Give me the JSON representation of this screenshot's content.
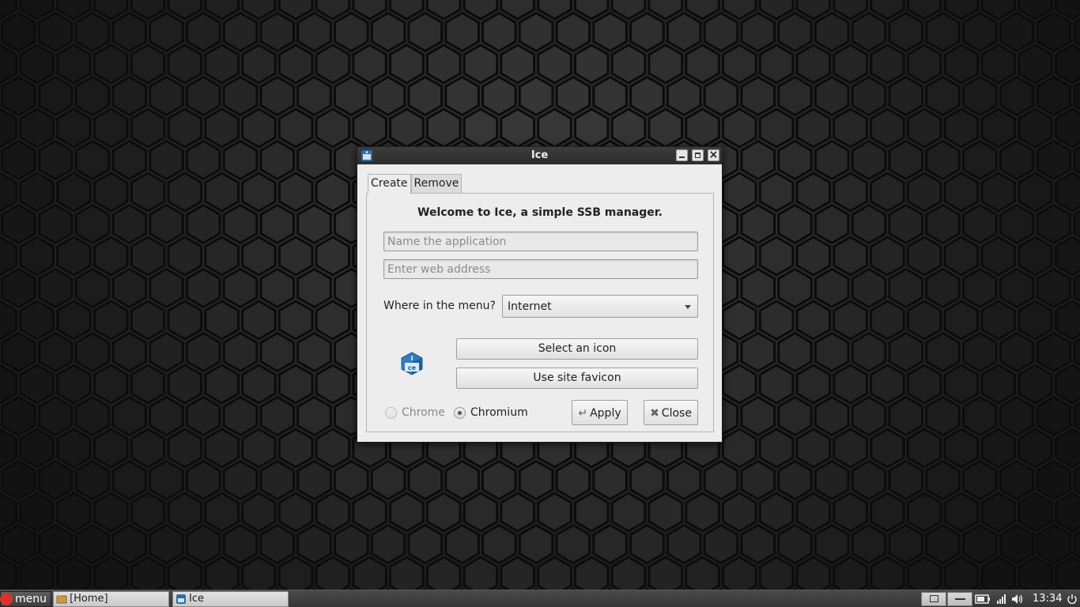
{
  "window": {
    "title": "Ice",
    "tabs": [
      {
        "label": "Create",
        "active": true
      },
      {
        "label": "Remove",
        "active": false
      }
    ],
    "welcome": "Welcome to Ice, a simple SSB manager.",
    "name_input": {
      "placeholder": "Name the application",
      "value": ""
    },
    "url_input": {
      "placeholder": "Enter web address",
      "value": ""
    },
    "menu_label": "Where in the menu?",
    "menu_select": {
      "value": "Internet"
    },
    "select_icon_label": "Select an icon",
    "favicon_label": "Use site favicon",
    "browsers": [
      {
        "label": "Chrome",
        "checked": false,
        "enabled": false
      },
      {
        "label": "Chromium",
        "checked": true,
        "enabled": true
      }
    ],
    "apply_label": "Apply",
    "close_label": "Close",
    "icon_letters": "ice"
  },
  "taskbar": {
    "menu_label": "menu",
    "tasks": [
      {
        "label": "[Home]",
        "icon": "folder-icon"
      },
      {
        "label": "Ice",
        "icon": "ice-app-icon"
      }
    ],
    "clock": "13:34",
    "tray_icons": [
      "workspace-icon",
      "window-icon",
      "battery-icon",
      "network-icon",
      "volume-icon",
      "power-icon"
    ]
  },
  "colors": {
    "desktop": "#262626",
    "titlebar": "#2d2d2d",
    "dialog": "#ededed",
    "menu_logo": "#d9342b"
  }
}
